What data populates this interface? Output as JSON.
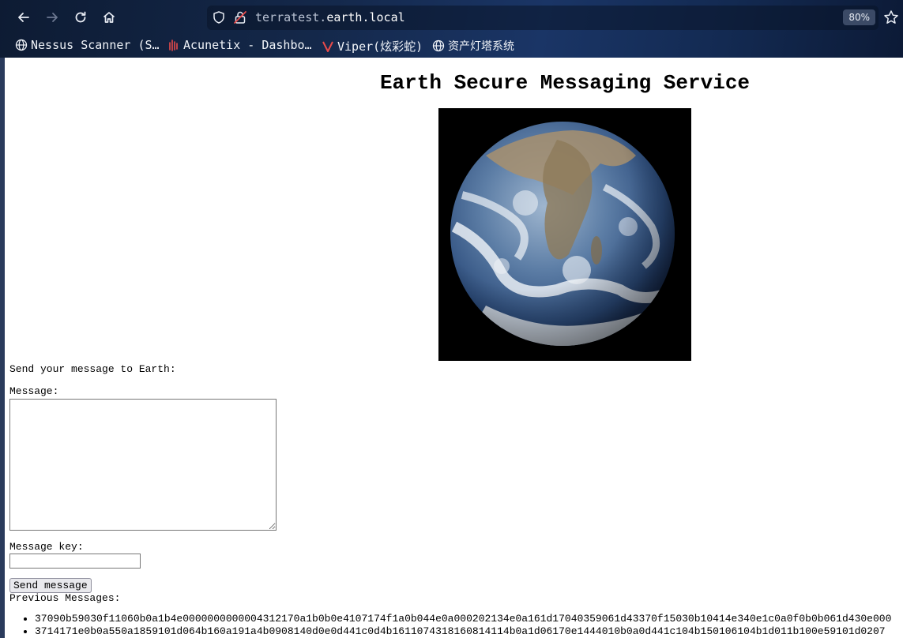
{
  "browser": {
    "url_host_prefix": "terratest.",
    "url_host_main": "earth.local",
    "zoom": "80%",
    "bookmarks": [
      {
        "label": "Nessus Scanner (S…",
        "icon": "globe-icon"
      },
      {
        "label": "Acunetix - Dashbo…",
        "icon": "acunetix-icon"
      },
      {
        "label": "Viper(炫彩蛇)",
        "icon": "viper-icon"
      },
      {
        "label": "资产灯塔系统",
        "icon": "globe-icon"
      }
    ],
    "accent": "#e84a4a"
  },
  "page": {
    "title": "Earth Secure Messaging Service",
    "send_heading": "Send your message to Earth:",
    "message_label": "Message:",
    "message_value": "",
    "key_label": "Message key:",
    "key_value": "",
    "send_button": "Send message",
    "previous_heading": "Previous Messages:",
    "messages": [
      "37090b59030f11060b0a1b4e0000000000004312170a1b0b0e4107174f1a0b044e0a000202134e0a161d17040359061d43370f15030b10414e340e1c0a0f0b0b061d430e000",
      "3714171e0b0a550a1859101d064b160a191a4b0908140d0e0d441c0d4b1611074318160814114b0a1d06170e1444010b0a0d441c104b150106104b1d011b100e59101d0207"
    ]
  }
}
